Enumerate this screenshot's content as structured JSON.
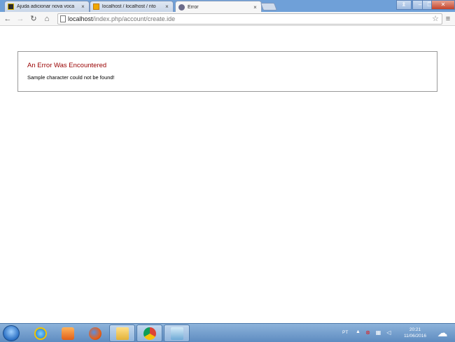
{
  "browser": {
    "tabs": [
      {
        "title": "Ajuda adicionar nova voca",
        "icon": "bookmark-favicon",
        "active": false
      },
      {
        "title": "localhost / localhost / nto",
        "icon": "phpmyadmin-favicon",
        "active": false
      },
      {
        "title": "Error",
        "icon": "globe-favicon",
        "active": true
      }
    ],
    "close_glyph": "×",
    "url_host": "localhost",
    "url_path": "/index.php/account/create.ide"
  },
  "page": {
    "error_heading": "An Error Was Encountered",
    "error_message": "Sample character could not be found!"
  },
  "taskbar": {
    "language": "PT",
    "time": "20:21",
    "date": "11/06/2016",
    "apps": [
      "internet-explorer",
      "media-player",
      "firefox",
      "file-explorer",
      "chrome",
      "generic-app"
    ]
  },
  "colors": {
    "error_heading": "#990000",
    "titlebar": "#6fa0d8"
  }
}
